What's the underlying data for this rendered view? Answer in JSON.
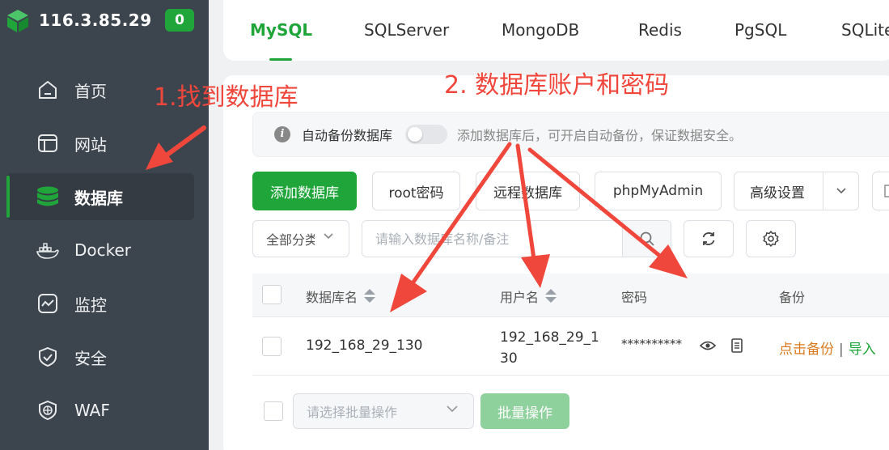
{
  "sidebar": {
    "server_ip": "116.3.85.29",
    "badge_count": "0",
    "items": [
      {
        "label": "首页",
        "icon": "home-icon"
      },
      {
        "label": "网站",
        "icon": "website-icon"
      },
      {
        "label": "数据库",
        "icon": "database-icon",
        "active": true
      },
      {
        "label": "Docker",
        "icon": "docker-icon"
      },
      {
        "label": "监控",
        "icon": "monitor-icon"
      },
      {
        "label": "安全",
        "icon": "shield-icon"
      },
      {
        "label": "WAF",
        "icon": "waf-icon"
      }
    ]
  },
  "tabs": [
    "MySQL",
    "SQLServer",
    "MongoDB",
    "Redis",
    "PgSQL",
    "SQLite"
  ],
  "active_tab": "MySQL",
  "notice": {
    "label": "自动备份数据库",
    "hint": "添加数据库后，可开启自动备份，保证数据安全。"
  },
  "toolbar": {
    "add": "添加数据库",
    "root_password": "root密码",
    "remote": "远程数据库",
    "phpmyadmin": "phpMyAdmin",
    "advanced": "高级设置"
  },
  "filter": {
    "category": "全部分类",
    "search_placeholder": "请输入数据库名称/备注"
  },
  "table": {
    "headers": {
      "name": "数据库名",
      "user": "用户名",
      "password": "密码",
      "backup": "备份"
    },
    "rows": [
      {
        "name": "192_168_29_130",
        "user": "192_168_29_130",
        "password": "**********",
        "backup_link": "点击备份",
        "separator": "|",
        "import_link": "导入"
      }
    ]
  },
  "batch": {
    "placeholder": "请选择批量操作",
    "button": "批量操作"
  },
  "annotations": {
    "step1": "1.找到数据库",
    "step2": "2. 数据库账户和密码"
  },
  "colors": {
    "brand_green": "#20a53a",
    "sidebar_bg": "#3c444d",
    "annotation_red": "#f0473c",
    "backup_orange": "#d97a1f"
  }
}
